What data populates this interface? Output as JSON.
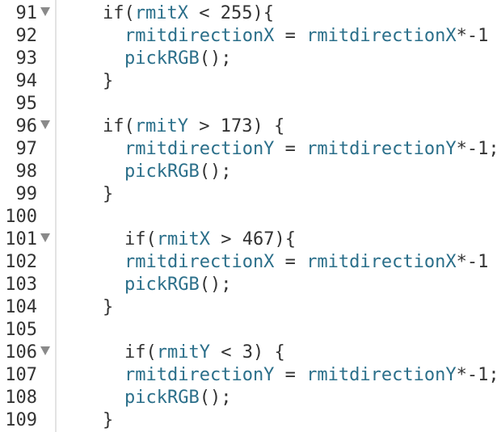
{
  "editor": {
    "lines": [
      {
        "num": "91",
        "fold": true,
        "indent": 1,
        "parts": [
          {
            "t": "if(",
            "c": "plain"
          },
          {
            "t": "rmitX",
            "c": "ident"
          },
          {
            "t": " < 255){",
            "c": "plain"
          }
        ]
      },
      {
        "num": "92",
        "fold": false,
        "indent": 2,
        "parts": [
          {
            "t": "rmitdirectionX",
            "c": "ident"
          },
          {
            "t": " = ",
            "c": "plain"
          },
          {
            "t": "rmitdirectionX",
            "c": "ident"
          },
          {
            "t": "*-1",
            "c": "plain"
          }
        ]
      },
      {
        "num": "93",
        "fold": false,
        "indent": 2,
        "parts": [
          {
            "t": "pickRGB",
            "c": "ident"
          },
          {
            "t": "();",
            "c": "plain"
          }
        ]
      },
      {
        "num": "94",
        "fold": false,
        "indent": 1,
        "parts": [
          {
            "t": "}",
            "c": "plain"
          }
        ]
      },
      {
        "num": "95",
        "fold": false,
        "indent": 0,
        "parts": []
      },
      {
        "num": "96",
        "fold": true,
        "indent": 1,
        "parts": [
          {
            "t": "if(",
            "c": "plain"
          },
          {
            "t": "rmitY",
            "c": "ident"
          },
          {
            "t": " > 173) {",
            "c": "plain"
          }
        ]
      },
      {
        "num": "97",
        "fold": false,
        "indent": 2,
        "parts": [
          {
            "t": "rmitdirectionY",
            "c": "ident"
          },
          {
            "t": " = ",
            "c": "plain"
          },
          {
            "t": "rmitdirectionY",
            "c": "ident"
          },
          {
            "t": "*-1;",
            "c": "plain"
          }
        ]
      },
      {
        "num": "98",
        "fold": false,
        "indent": 2,
        "parts": [
          {
            "t": "pickRGB",
            "c": "ident"
          },
          {
            "t": "();",
            "c": "plain"
          }
        ]
      },
      {
        "num": "99",
        "fold": false,
        "indent": 1,
        "parts": [
          {
            "t": "}",
            "c": "plain"
          }
        ]
      },
      {
        "num": "100",
        "fold": false,
        "indent": 0,
        "parts": []
      },
      {
        "num": "101",
        "fold": true,
        "indent": 2,
        "parts": [
          {
            "t": "if(",
            "c": "plain"
          },
          {
            "t": "rmitX",
            "c": "ident"
          },
          {
            "t": " > 467){",
            "c": "plain"
          }
        ]
      },
      {
        "num": "102",
        "fold": false,
        "indent": 2,
        "parts": [
          {
            "t": "rmitdirectionX",
            "c": "ident"
          },
          {
            "t": " = ",
            "c": "plain"
          },
          {
            "t": "rmitdirectionX",
            "c": "ident"
          },
          {
            "t": "*-1",
            "c": "plain"
          }
        ]
      },
      {
        "num": "103",
        "fold": false,
        "indent": 2,
        "parts": [
          {
            "t": "pickRGB",
            "c": "ident"
          },
          {
            "t": "();",
            "c": "plain"
          }
        ]
      },
      {
        "num": "104",
        "fold": false,
        "indent": 1,
        "parts": [
          {
            "t": "}",
            "c": "plain"
          }
        ]
      },
      {
        "num": "105",
        "fold": false,
        "indent": 0,
        "parts": []
      },
      {
        "num": "106",
        "fold": true,
        "indent": 2,
        "parts": [
          {
            "t": "if(",
            "c": "plain"
          },
          {
            "t": "rmitY",
            "c": "ident"
          },
          {
            "t": " < 3) {",
            "c": "plain"
          }
        ]
      },
      {
        "num": "107",
        "fold": false,
        "indent": 2,
        "parts": [
          {
            "t": "rmitdirectionY",
            "c": "ident"
          },
          {
            "t": " = ",
            "c": "plain"
          },
          {
            "t": "rmitdirectionY",
            "c": "ident"
          },
          {
            "t": "*-1;",
            "c": "plain"
          }
        ]
      },
      {
        "num": "108",
        "fold": false,
        "indent": 2,
        "parts": [
          {
            "t": "pickRGB",
            "c": "ident"
          },
          {
            "t": "();",
            "c": "plain"
          }
        ]
      },
      {
        "num": "109",
        "fold": false,
        "indent": 1,
        "parts": [
          {
            "t": "}",
            "c": "plain"
          }
        ]
      }
    ]
  },
  "colors": {
    "identifier": "#2b6f8a",
    "text": "#333333",
    "fold_marker": "#8a8a8a",
    "gutter_border": "#e3e3e3",
    "background": "#ffffff"
  }
}
